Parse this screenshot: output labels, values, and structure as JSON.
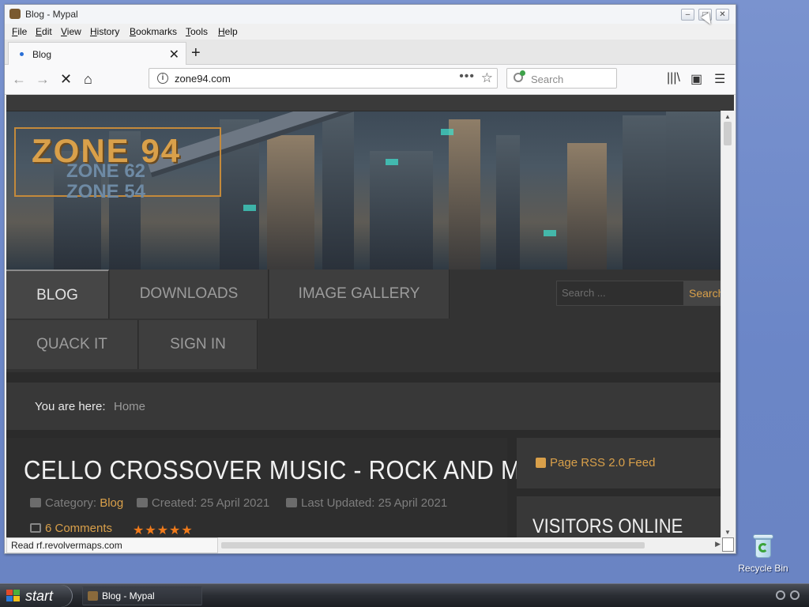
{
  "desktop": {
    "icons": [
      {
        "label": "Recycle Bin",
        "icon": "recycle-bin-icon"
      }
    ]
  },
  "taskbar": {
    "start_label": "start",
    "items": [
      {
        "label": "Blog - Mypal",
        "icon": "mypal-icon"
      }
    ]
  },
  "window": {
    "title": "Blog - Mypal",
    "controls": [
      "minimize",
      "maximize",
      "close"
    ]
  },
  "menubar": {
    "items": [
      "File",
      "Edit",
      "View",
      "History",
      "Bookmarks",
      "Tools",
      "Help"
    ]
  },
  "tabs": [
    {
      "label": "Blog",
      "loading": true
    }
  ],
  "navbar": {
    "url": "zone94.com",
    "search_placeholder": "Search"
  },
  "page": {
    "logo_main": "ZONE 94",
    "logo_sub1": "ZONE 62",
    "logo_sub2": "ZONE 54",
    "nav_row1": [
      "BLOG",
      "DOWNLOADS",
      "IMAGE GALLERY"
    ],
    "nav_row2": [
      "QUACK IT",
      "SIGN IN"
    ],
    "search_placeholder": "Search ...",
    "search_button": "Search",
    "breadcrumb_label": "You are here:",
    "breadcrumb_home": "Home",
    "article": {
      "title": "CELLO CROSSOVER MUSIC - ROCK AND METAL",
      "category_label": "Category:",
      "category": "Blog",
      "created": "Created: 25 April 2021",
      "updated": "Last Updated: 25 April 2021",
      "comments": "6 Comments",
      "rating_stars": 5
    },
    "sidebar": {
      "rss": "Page RSS 2.0 Feed",
      "visitors": "VISITORS ONLINE"
    }
  },
  "status": {
    "text": "Read rf.revolvermaps.com"
  },
  "colors": {
    "accent": "#d9a04a",
    "stars": "#f07a1a",
    "desktop": "#6b86c7"
  }
}
